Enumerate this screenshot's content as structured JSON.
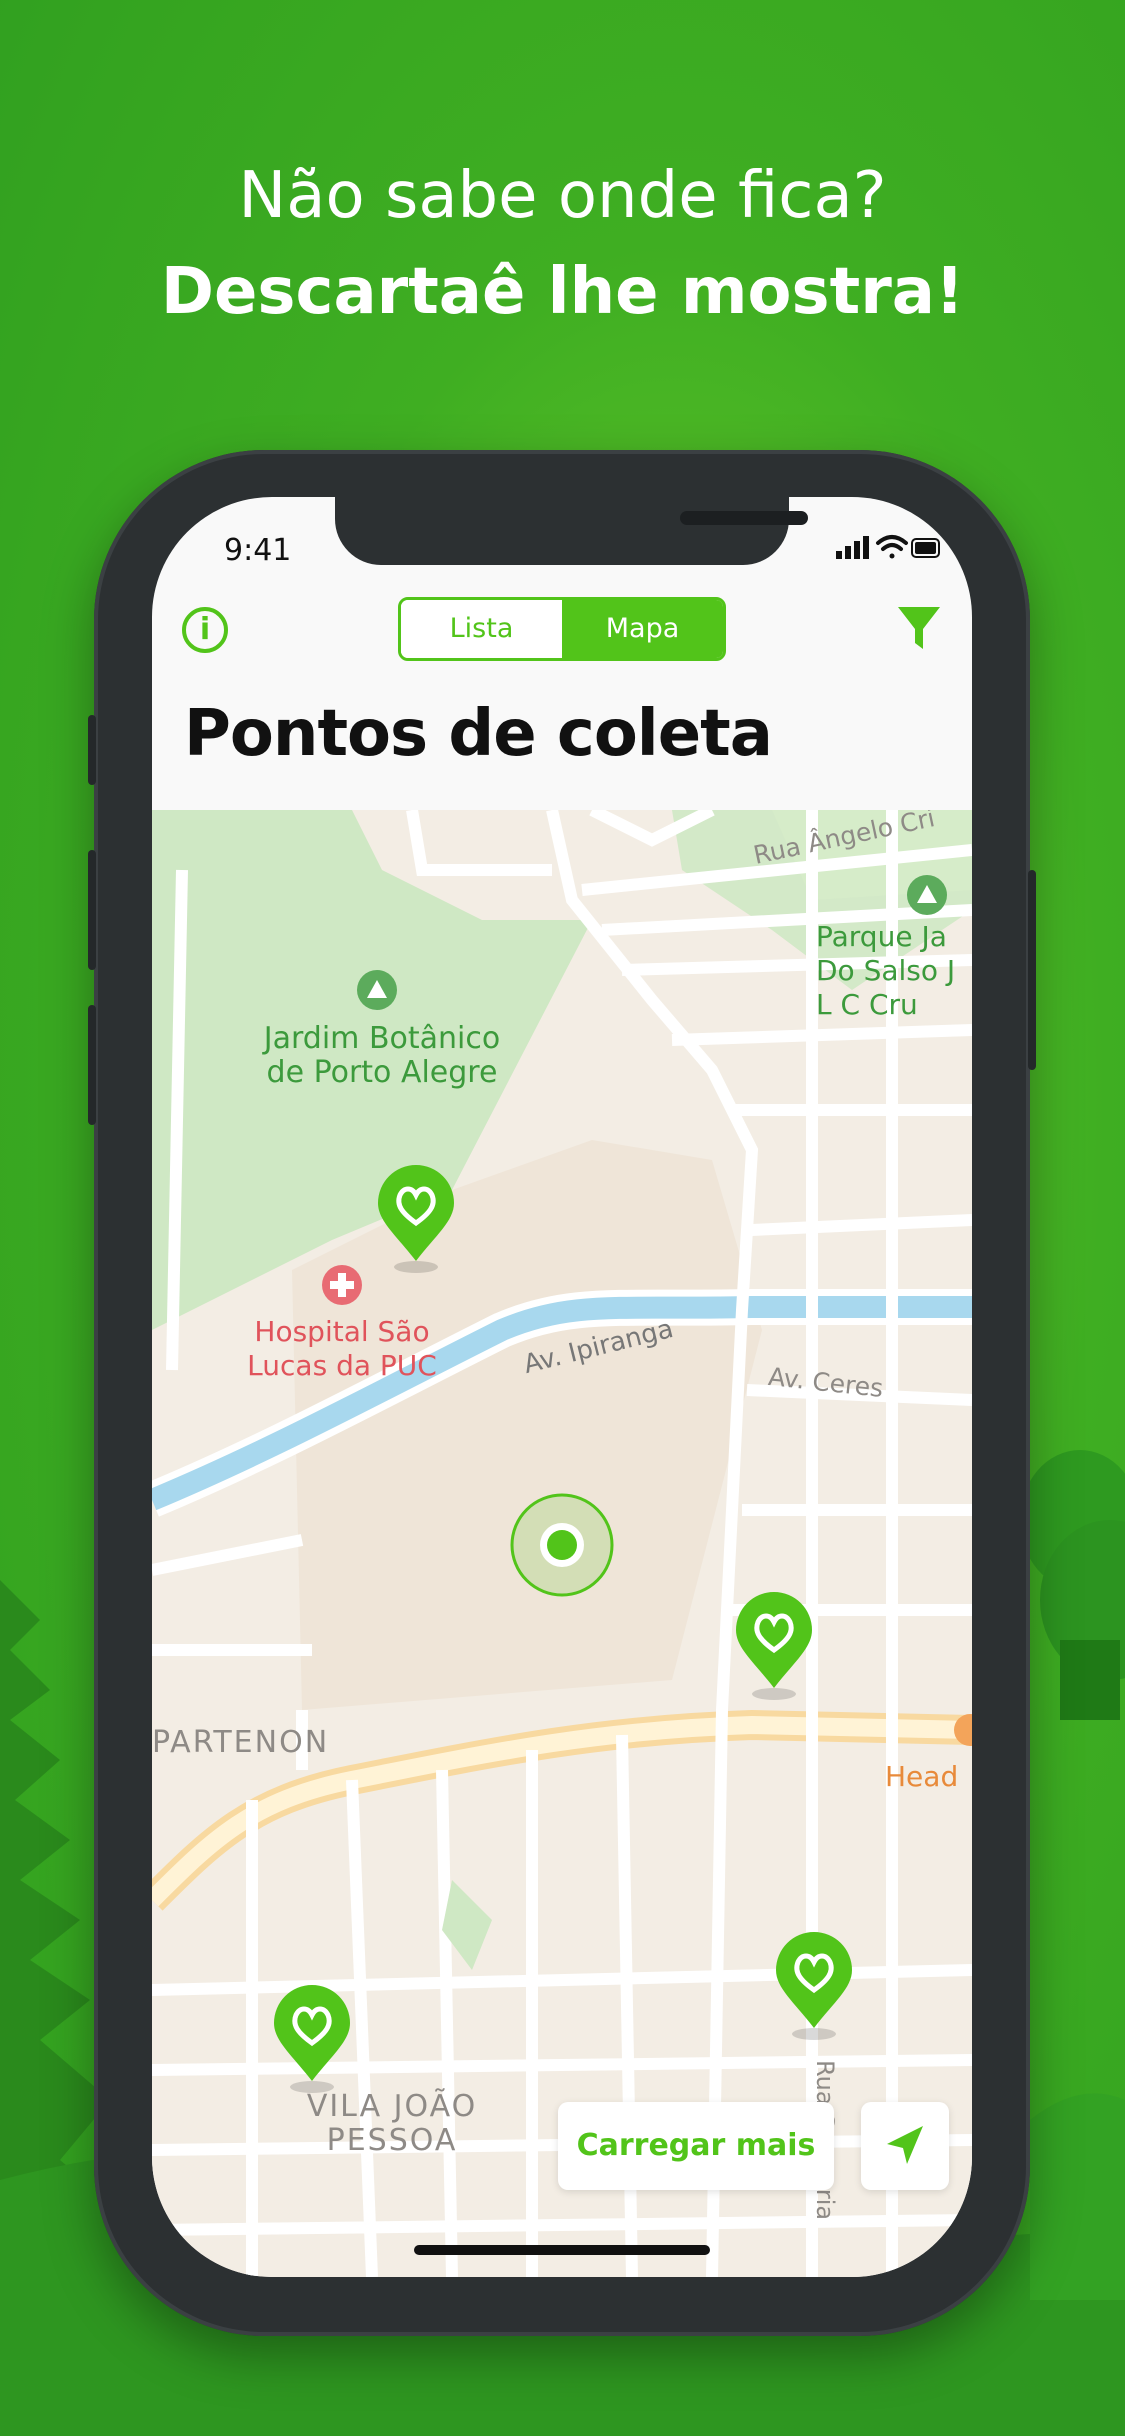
{
  "headline": {
    "line1": "Não sabe onde fica?",
    "line2": "Descartaê lhe mostra!"
  },
  "status_bar": {
    "time": "9:41",
    "icons": [
      "signal-icon",
      "wifi-icon",
      "battery-icon"
    ]
  },
  "nav": {
    "info_icon": "info-icon",
    "segments": [
      {
        "label": "Lista",
        "selected": false
      },
      {
        "label": "Mapa",
        "selected": true
      }
    ],
    "filter_icon": "filter-icon"
  },
  "page_title": "Pontos de coleta",
  "map": {
    "labels": {
      "street_angelo": "Rua Ângelo Cri",
      "parque": "Parque Ja\nDo Salso J\nL C Cru",
      "jardim": "Jardim Botânico\nde Porto Alegre",
      "hospital": "Hospital São\nLucas da PUC",
      "ipiranga": "Av. Ipiranga",
      "ceres": "Av. Ceres",
      "partenon": "PARTENON",
      "head": "Head",
      "vila": "VILA JOÃO\nPESSOA",
      "rua_sa": "Rua Sa      ria"
    },
    "pins": [
      "recycle-pin",
      "recycle-pin",
      "recycle-pin",
      "recycle-pin"
    ]
  },
  "actions": {
    "load_more": "Carregar mais",
    "locate_icon": "location-arrow-icon"
  },
  "colors": {
    "accent": "#52c41a",
    "background": "#3fae22",
    "map_land": "#f3ede4",
    "park": "#cfe8c4",
    "water": "#a8d8ee"
  }
}
